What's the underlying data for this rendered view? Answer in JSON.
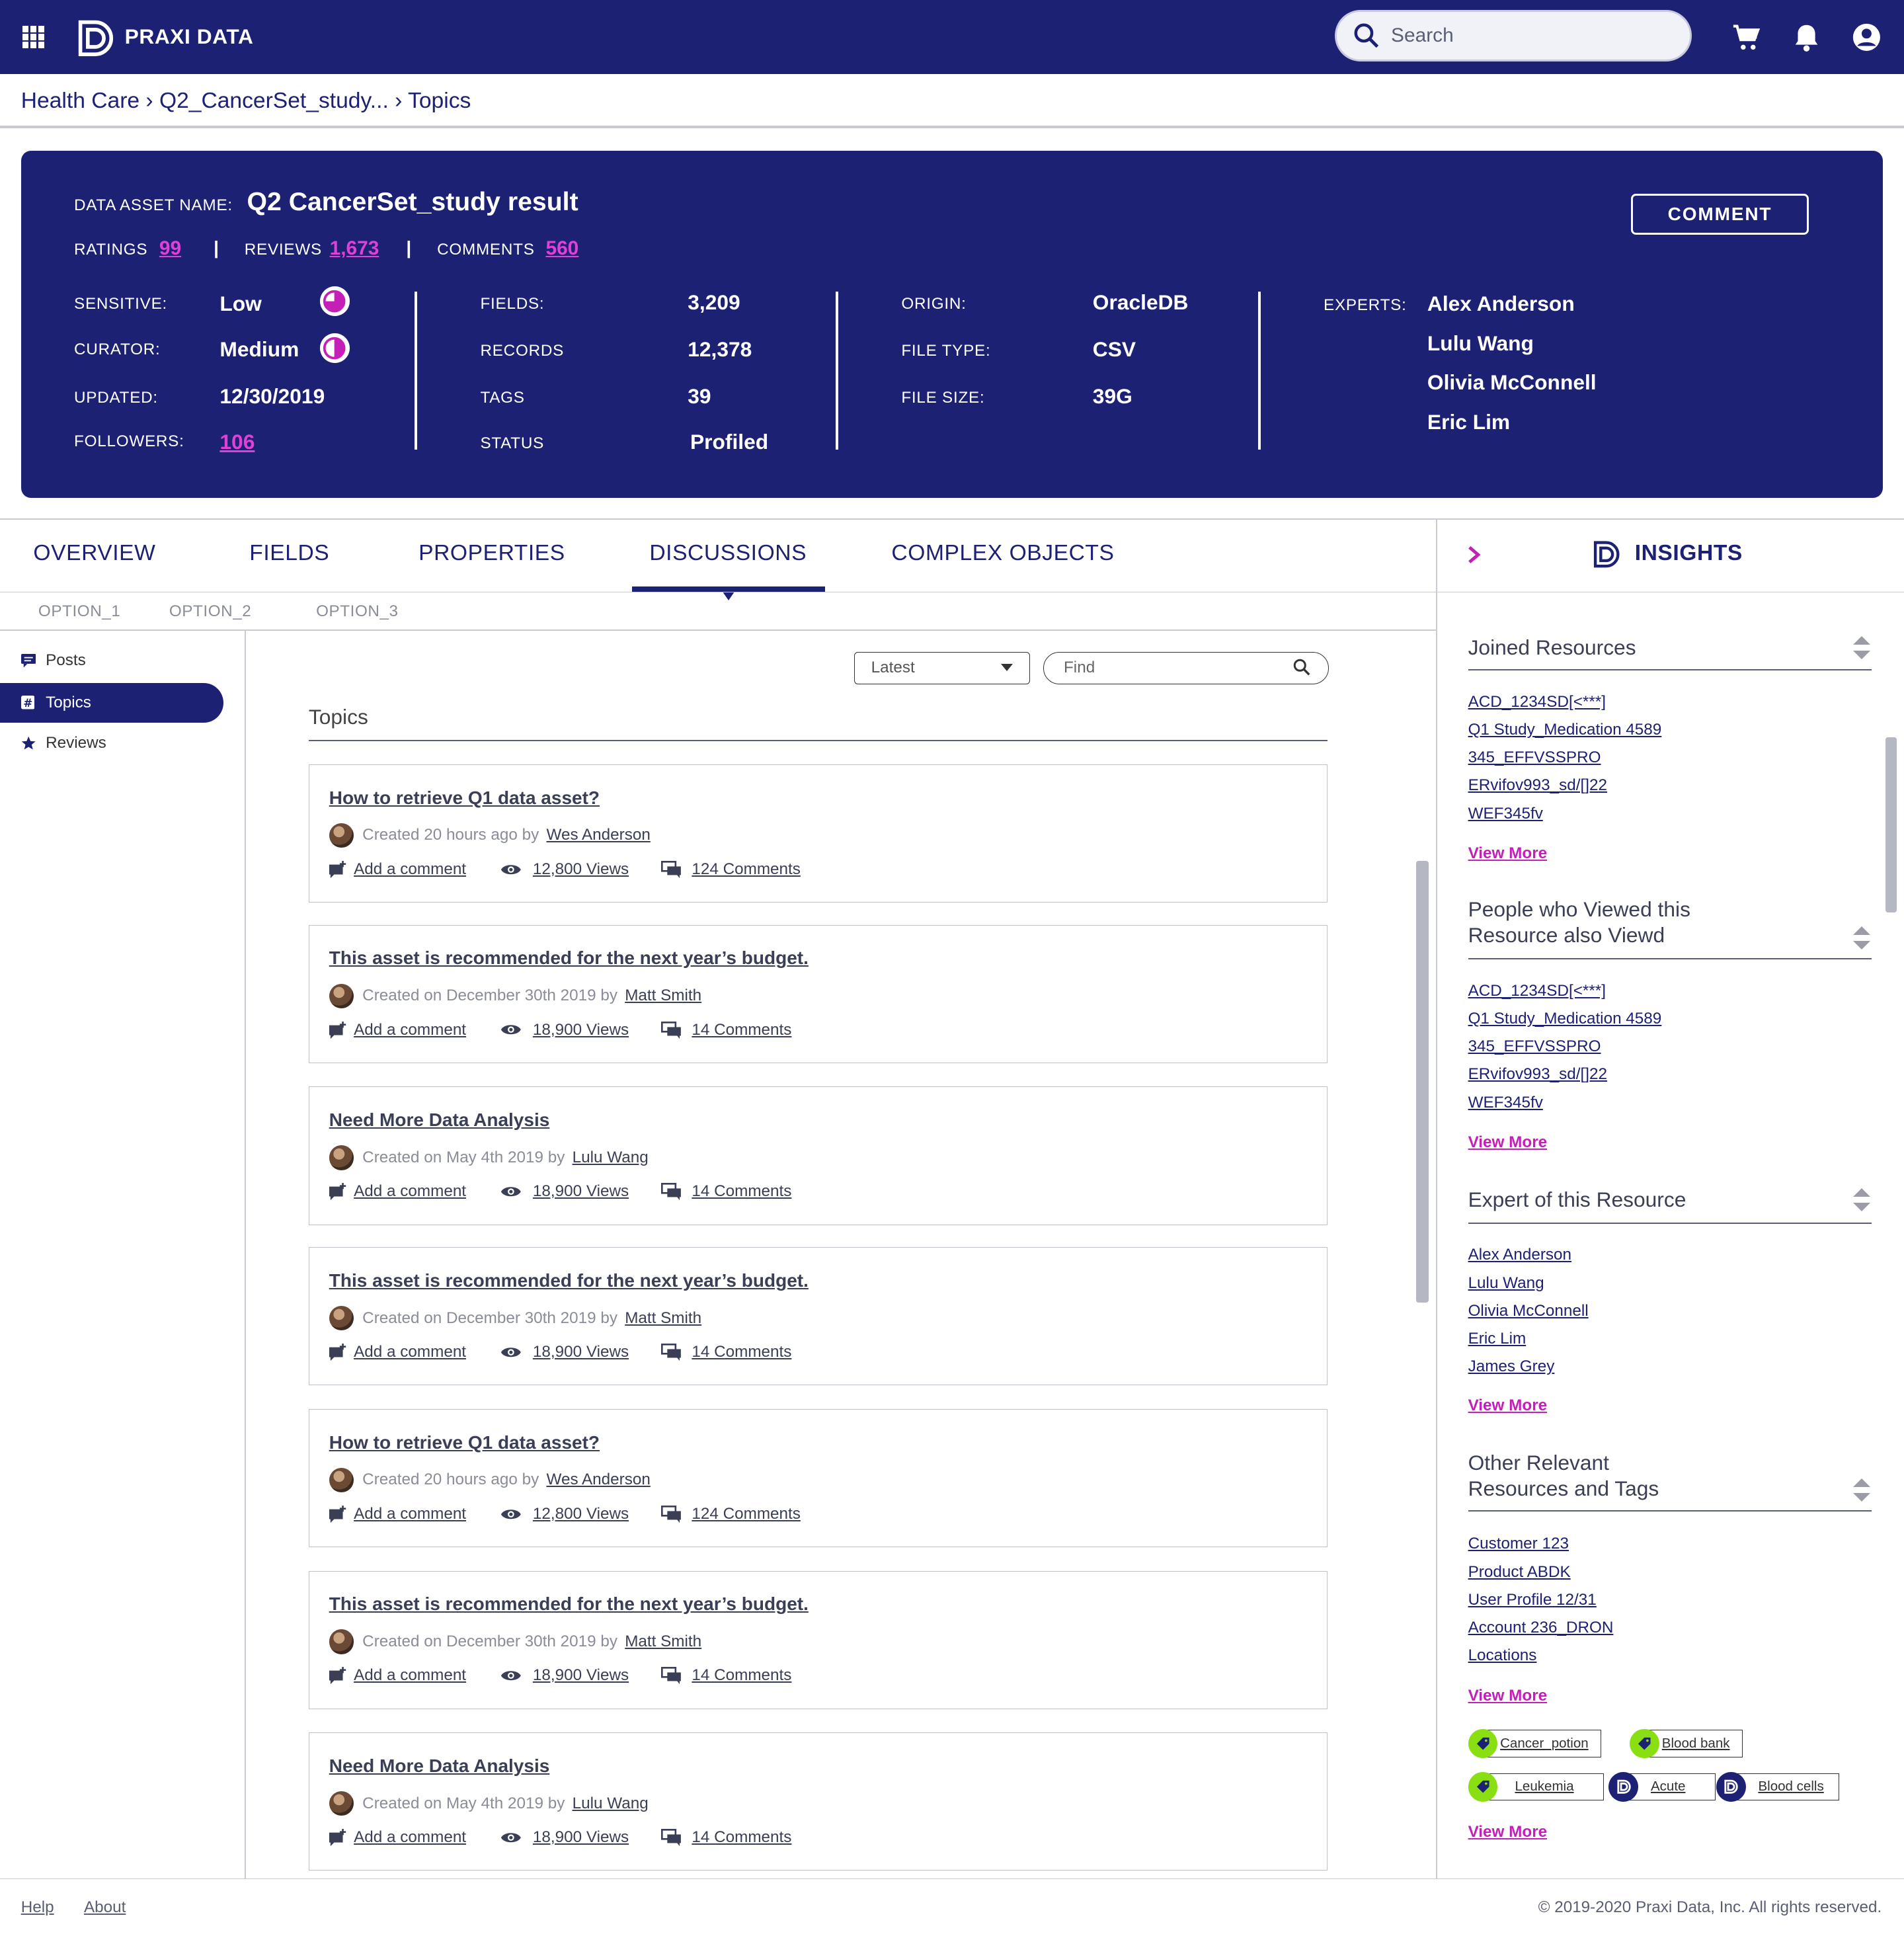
{
  "app": {
    "brand": "PRAXI DATA"
  },
  "search": {
    "placeholder": "Search"
  },
  "breadcrumb": "Health Care › Q2_CancerSet_study... › Topics",
  "asset": {
    "name_label": "DATA ASSET NAME:",
    "name": "Q2 CancerSet_study result",
    "ratings_label": "RATINGS",
    "ratings": "99",
    "reviews_label": "REVIEWS",
    "reviews": "1,673",
    "comments_label": "COMMENTS",
    "comments": "560",
    "comment_button": "COMMENT",
    "sensitive_label": "SENSITIVE:",
    "sensitive": "Low",
    "curator_label": "CURATOR:",
    "curator": "Medium",
    "updated_label": "UPDATED:",
    "updated": "12/30/2019",
    "followers_label": "FOLLOWERS:",
    "followers": "106",
    "fields_label": "FIELDS:",
    "fields": "3,209",
    "records_label": "RECORDS",
    "records": "12,378",
    "tags_label": "TAGS",
    "tags": "39",
    "status_label": "STATUS",
    "status": "Profiled",
    "origin_label": "ORIGIN:",
    "origin": "OracleDB",
    "filetype_label": "FILE TYPE:",
    "filetype": "CSV",
    "filesize_label": "FILE SIZE:",
    "filesize": "39G",
    "experts_label": "EXPERTS:",
    "experts": [
      "Alex Anderson",
      "Lulu Wang",
      "Olivia McConnell",
      "Eric Lim"
    ]
  },
  "tabs": [
    "OVERVIEW",
    "FIELDS",
    "PROPERTIES",
    "DISCUSSIONS",
    "COMPLEX OBJECTS"
  ],
  "subtabs": [
    "OPTION_1",
    "OPTION_2",
    "OPTION_3"
  ],
  "nav": [
    "Posts",
    "Topics",
    "Reviews"
  ],
  "filters": {
    "sort": "Latest",
    "find_placeholder": "Find"
  },
  "topics_title": "Topics",
  "posts": [
    {
      "title": "How to retrieve Q1 data asset?",
      "created": "Created 20 hours ago by",
      "author": "Wes Anderson",
      "add": "Add a comment",
      "views": "12,800 Views",
      "comments": "124 Comments"
    },
    {
      "title": "This asset is recommended for the next year’s budget.",
      "created": "Created on December 30th 2019 by",
      "author": "Matt Smith",
      "add": "Add a comment",
      "views": "18,900 Views",
      "comments": "14 Comments"
    },
    {
      "title": "Need More Data Analysis",
      "created": "Created on May 4th 2019 by",
      "author": "Lulu Wang",
      "add": "Add a comment",
      "views": "18,900 Views",
      "comments": "14 Comments"
    },
    {
      "title": "This asset is recommended for the next year’s budget.",
      "created": "Created on December 30th 2019 by",
      "author": "Matt Smith",
      "add": "Add a comment",
      "views": "18,900 Views",
      "comments": "14 Comments"
    },
    {
      "title": "How to retrieve Q1 data asset?",
      "created": "Created 20 hours ago by",
      "author": "Wes Anderson",
      "add": "Add a comment",
      "views": "12,800 Views",
      "comments": "124 Comments"
    },
    {
      "title": "This asset is recommended for the next year’s budget.",
      "created": "Created on December 30th 2019 by",
      "author": "Matt Smith",
      "add": "Add a comment",
      "views": "18,900 Views",
      "comments": "14 Comments"
    },
    {
      "title": "Need More Data Analysis",
      "created": "Created on May 4th 2019 by",
      "author": "Lulu Wang",
      "add": "Add a comment",
      "views": "18,900 Views",
      "comments": "14 Comments"
    }
  ],
  "insights": {
    "title": "INSIGHTS",
    "joined_title": "Joined Resources",
    "joined": [
      "ACD_1234SD[<***]",
      "Q1 Study_Medication 4589",
      "345_EFFVSSPRO",
      "ERvifov993_sd/[]22",
      "WEF345fv"
    ],
    "viewed_title_1": "People who Viewed this",
    "viewed_title_2": "Resource also Viewd",
    "viewed": [
      "ACD_1234SD[<***]",
      "Q1 Study_Medication 4589",
      "345_EFFVSSPRO",
      "ERvifov993_sd/[]22",
      "WEF345fv"
    ],
    "expert_title": "Expert of this Resource",
    "expert": [
      "Alex Anderson",
      "Lulu Wang",
      "Olivia McConnell",
      "Eric Lim",
      "James Grey"
    ],
    "other_title_1": "Other Relevant",
    "other_title_2": "Resources and Tags",
    "other": [
      "Customer 123",
      "Product ABDK",
      "User Profile 12/31",
      "Account 236_DRON",
      "Locations"
    ],
    "view_more": "View More",
    "tags": [
      "Cancer_potion",
      "Blood bank",
      "Leukemia",
      "Acute",
      "Blood cells"
    ]
  },
  "footer": {
    "help": "Help",
    "about": "About",
    "copyright": "© 2019-2020 Praxi Data, Inc. All rights reserved."
  },
  "colors": {
    "navy": "#1d2173",
    "pink": "#e040d8",
    "green": "#8adf12"
  }
}
